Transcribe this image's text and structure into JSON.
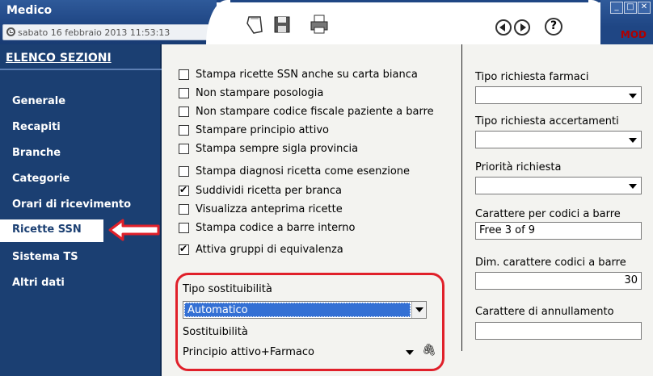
{
  "window": {
    "title": "Medico",
    "datetime": "sabato 16 febbraio 2013   11:53:13",
    "mode": "MOD"
  },
  "toolbar": {
    "icons": [
      "eraser-icon",
      "save-icon",
      "print-icon"
    ],
    "nav_icons": [
      "back-icon",
      "forward-icon",
      "help-icon"
    ]
  },
  "sidebar": {
    "header": "ELENCO SEZIONI",
    "items": [
      {
        "label": "Generale"
      },
      {
        "label": "Recapiti"
      },
      {
        "label": "Branche"
      },
      {
        "label": "Categorie"
      },
      {
        "label": "Orari di ricevimento"
      },
      {
        "label": "Ricette SSN"
      },
      {
        "label": "Sistema TS"
      },
      {
        "label": "Altri dati"
      }
    ],
    "active": "Ricette SSN"
  },
  "options": [
    {
      "label": "Stampa ricette SSN anche su carta bianca",
      "checked": false
    },
    {
      "label": "Non stampare posologia",
      "checked": false
    },
    {
      "label": "Non stampare codice fiscale paziente a barre",
      "checked": false
    },
    {
      "label": "Stampare principio attivo",
      "checked": false
    },
    {
      "label": "Stampa sempre sigla provincia",
      "checked": false
    },
    {
      "label": "Stampa diagnosi ricetta come esenzione",
      "checked": false
    },
    {
      "label": "Suddividi ricetta per branca",
      "checked": true
    },
    {
      "label": "Visualizza anteprima ricette",
      "checked": false
    },
    {
      "label": "Stampa codice a barre interno",
      "checked": false
    },
    {
      "label": "Attiva gruppi di equivalenza",
      "checked": true
    }
  ],
  "substitution": {
    "type_label": "Tipo sostituibilità",
    "type_value": "Automatico",
    "label": "Sostituibilità",
    "value": "Principio attivo+Farmaco"
  },
  "right_panel": {
    "tipo_farmaci_label": "Tipo richiesta farmaci",
    "tipo_farmaci_value": "",
    "tipo_accertamenti_label": "Tipo richiesta accertamenti",
    "tipo_accertamenti_value": "",
    "priorita_label": "Priorità richiesta",
    "priorita_value": "",
    "barcode_font_label": "Carattere per codici a barre",
    "barcode_font_value": "Free 3 of 9",
    "barcode_size_label": "Dim. carattere codici a barre",
    "barcode_size_value": "30",
    "cancel_font_label": "Carattere di annullamento",
    "cancel_font_value": ""
  },
  "colors": {
    "sidebar_bg": "#1b3f72",
    "highlight_red": "#e0202a",
    "selection_blue": "#3470d4"
  }
}
